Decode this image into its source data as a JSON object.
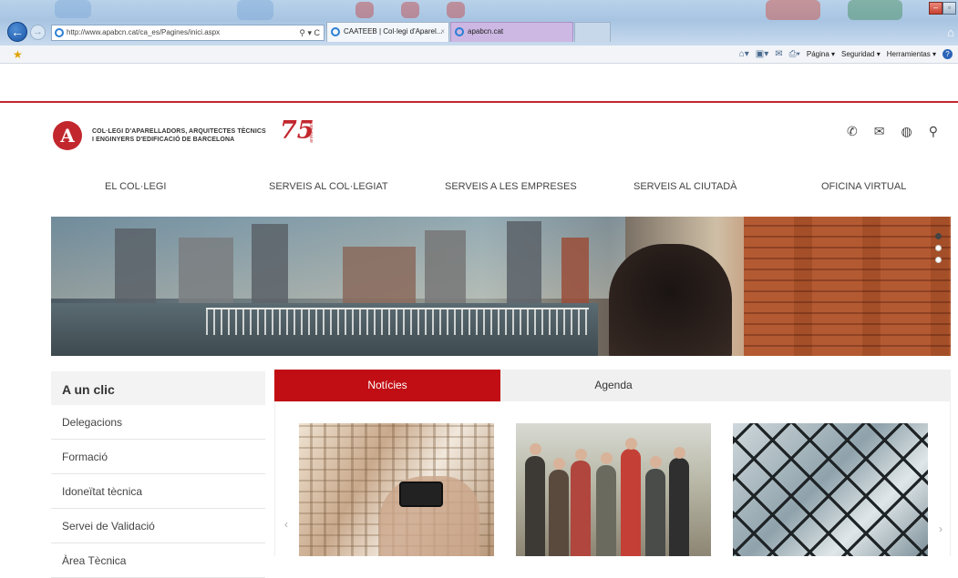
{
  "browser": {
    "url": "http://www.apabcn.cat/ca_es/Pagines/inici.aspx",
    "address_tools": "⚲ ▾ C",
    "tabs": [
      {
        "label": "CAATEEB | Col·legi d'Aparel...",
        "close": "×"
      },
      {
        "label": "apabcn.cat"
      }
    ],
    "command_bar": [
      "Página ▾",
      "Seguridad ▾",
      "Herramientas ▾"
    ]
  },
  "header": {
    "logo_lines": [
      "COL·LEGI D'APARELLADORS, ARQUITECTES TÈCNICS",
      "I ENGINYERS D'EDIFICACIÓ DE BARCELONA"
    ],
    "anniversary": "75",
    "anniversary_sub": "aniversari",
    "icons": [
      "phone-icon",
      "mail-icon",
      "globe-icon",
      "search-icon"
    ]
  },
  "nav": [
    "EL COL·LEGI",
    "SERVEIS AL COL·LEGIAT",
    "SERVEIS A LES EMPRESES",
    "SERVEIS AL CIUTADÀ",
    "OFICINA VIRTUAL"
  ],
  "slider": {
    "slides": 3,
    "active": 0
  },
  "sidebar": {
    "title": "A un clic",
    "items": [
      "Delegacions",
      "Formació",
      "Idoneïtat tècnica",
      "Servei de Validació",
      "Àrea Tècnica"
    ]
  },
  "content_tabs": [
    "Notícies",
    "Agenda"
  ],
  "colors": {
    "brand_red": "#c1272d",
    "tab_red": "#c10e14"
  }
}
